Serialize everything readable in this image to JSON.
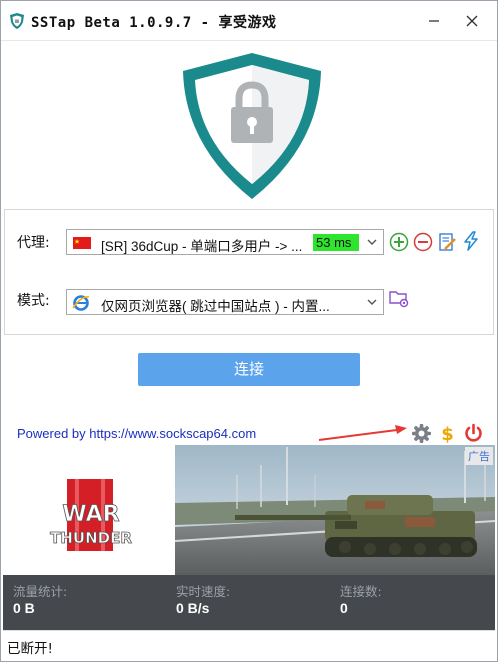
{
  "window": {
    "title": "SSTap Beta 1.0.9.7 - 享受游戏",
    "minimize_icon": "minimize-icon",
    "close_icon": "close-icon"
  },
  "colors": {
    "shield_teal": "#1a8a8c",
    "shield_fill": "#ffffff",
    "lock_gray": "#b0b3b6",
    "connect_button": "#5ba3ea",
    "latency_green": "#2de52d",
    "stats_bg": "#45494e",
    "link_blue": "#1b2fbf",
    "arrow_red": "#e53935"
  },
  "proxy": {
    "label": "代理:",
    "selected": "[SR] 36dCup - 单端口多用户 -> ...",
    "latency": "53 ms",
    "flag_icon": "china-flag-icon",
    "actions": [
      "add-proxy-icon",
      "remove-proxy-icon",
      "edit-proxy-icon",
      "test-speed-icon"
    ]
  },
  "mode": {
    "label": "模式:",
    "selected": "仅网页浏览器( 跳过中国站点 ) - 内置...",
    "browser_icon": "ie-browser-icon",
    "action": "rules-folder-icon"
  },
  "connect": {
    "label": "连接"
  },
  "footer_link": {
    "text": "Powered by https://www.sockscap64.com"
  },
  "footer_icons": [
    "settings-gear-icon",
    "donate-dollar-icon",
    "power-icon"
  ],
  "ad": {
    "badge": "广告",
    "logo_line1": "WAR",
    "logo_line2": "THUNDER"
  },
  "stats": {
    "traffic_label": "流量统计:",
    "traffic_value": "0 B",
    "speed_label": "实时速度:",
    "speed_value": "0 B/s",
    "connections_label": "连接数:",
    "connections_value": "0"
  },
  "status": {
    "text": "已断开!"
  }
}
